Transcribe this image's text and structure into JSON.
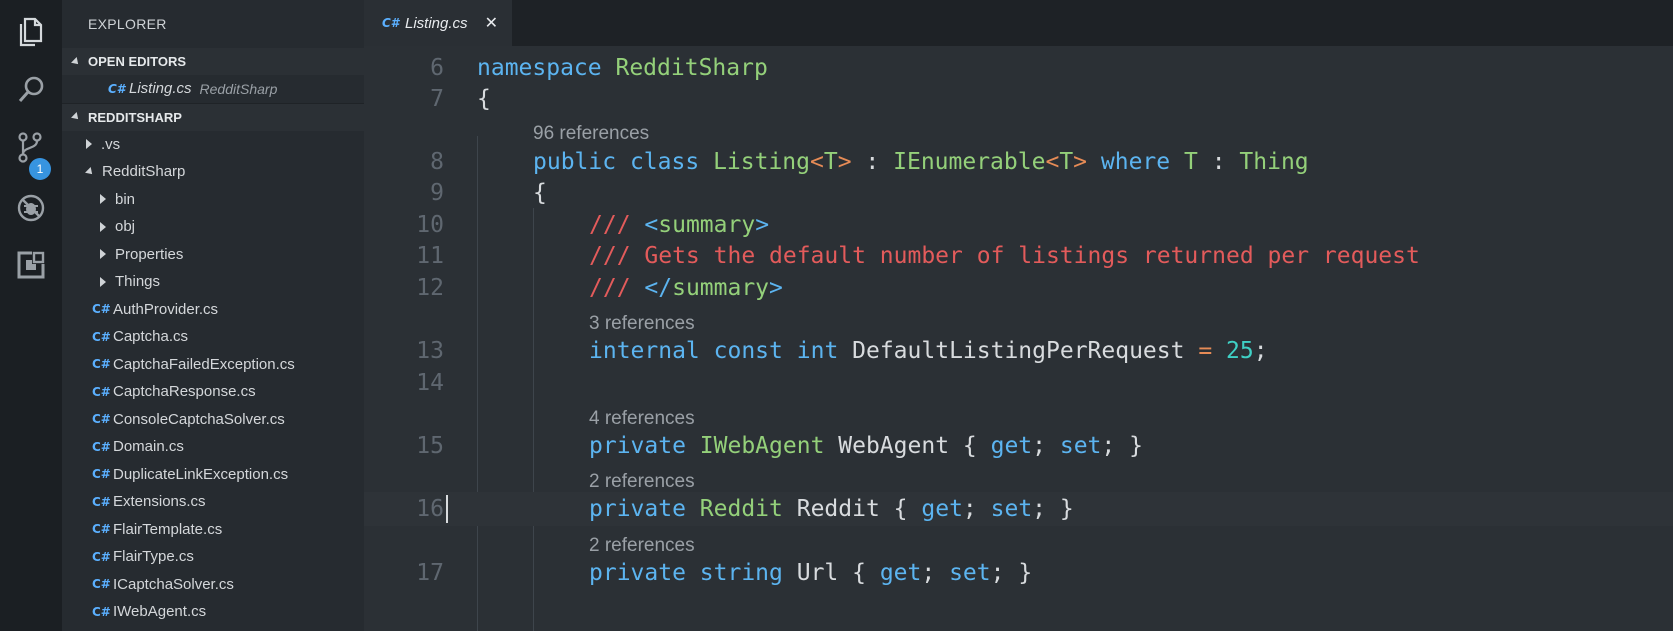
{
  "activity": {
    "items": [
      {
        "name": "explorer-icon"
      },
      {
        "name": "search-icon"
      },
      {
        "name": "source-control-icon",
        "badge": "1"
      },
      {
        "name": "debug-icon"
      },
      {
        "name": "extensions-icon"
      }
    ]
  },
  "sidebar": {
    "title": "EXPLORER",
    "open_editors": {
      "label": "OPEN EDITORS",
      "files": [
        {
          "name": "Listing.cs",
          "project": "RedditSharp"
        }
      ]
    },
    "project": {
      "label": "REDDITSHARP",
      "items": [
        {
          "label": ".vs",
          "type": "folder",
          "depth": 1,
          "expanded": false
        },
        {
          "label": "RedditSharp",
          "type": "folder",
          "depth": 1,
          "expanded": true
        },
        {
          "label": "bin",
          "type": "folder",
          "depth": 2,
          "expanded": false
        },
        {
          "label": "obj",
          "type": "folder",
          "depth": 2,
          "expanded": false
        },
        {
          "label": "Properties",
          "type": "folder",
          "depth": 2,
          "expanded": false
        },
        {
          "label": "Things",
          "type": "folder",
          "depth": 2,
          "expanded": false
        },
        {
          "label": "AuthProvider.cs",
          "type": "file",
          "depth": 2
        },
        {
          "label": "Captcha.cs",
          "type": "file",
          "depth": 2
        },
        {
          "label": "CaptchaFailedException.cs",
          "type": "file",
          "depth": 2
        },
        {
          "label": "CaptchaResponse.cs",
          "type": "file",
          "depth": 2
        },
        {
          "label": "ConsoleCaptchaSolver.cs",
          "type": "file",
          "depth": 2
        },
        {
          "label": "Domain.cs",
          "type": "file",
          "depth": 2
        },
        {
          "label": "DuplicateLinkException.cs",
          "type": "file",
          "depth": 2
        },
        {
          "label": "Extensions.cs",
          "type": "file",
          "depth": 2
        },
        {
          "label": "FlairTemplate.cs",
          "type": "file",
          "depth": 2
        },
        {
          "label": "FlairType.cs",
          "type": "file",
          "depth": 2
        },
        {
          "label": "ICaptchaSolver.cs",
          "type": "file",
          "depth": 2
        },
        {
          "label": "IWebAgent.cs",
          "type": "file",
          "depth": 2
        }
      ]
    }
  },
  "tab": {
    "label": "Listing.cs",
    "icon": "C#",
    "close": "✕"
  },
  "editor": {
    "lines": [
      {
        "num": "6",
        "indent": 0,
        "tokens": [
          [
            "kw",
            "namespace"
          ],
          [
            "pl",
            " "
          ],
          [
            "ty",
            "RedditSharp"
          ]
        ]
      },
      {
        "num": "7",
        "indent": 0,
        "tokens": [
          [
            "pl",
            "{"
          ]
        ]
      },
      {
        "num": "8",
        "indent": 1,
        "lens": "96 references",
        "tokens": [
          [
            "kw",
            "public"
          ],
          [
            "pl",
            " "
          ],
          [
            "kw",
            "class"
          ],
          [
            "pl",
            " "
          ],
          [
            "ty",
            "Listing"
          ],
          [
            "op",
            "<"
          ],
          [
            "ty",
            "T"
          ],
          [
            "op",
            ">"
          ],
          [
            "pl",
            " : "
          ],
          [
            "ty",
            "IEnumerable"
          ],
          [
            "op",
            "<"
          ],
          [
            "ty",
            "T"
          ],
          [
            "op",
            ">"
          ],
          [
            "pl",
            " "
          ],
          [
            "kw",
            "where"
          ],
          [
            "pl",
            " "
          ],
          [
            "ty",
            "T"
          ],
          [
            "pl",
            " : "
          ],
          [
            "ty",
            "Thing"
          ]
        ]
      },
      {
        "num": "9",
        "indent": 1,
        "tokens": [
          [
            "pl",
            "{"
          ]
        ]
      },
      {
        "num": "10",
        "indent": 2,
        "tokens": [
          [
            "cm",
            "/// "
          ],
          [
            "kw",
            "<"
          ],
          [
            "ty",
            "summary"
          ],
          [
            "kw",
            ">"
          ]
        ]
      },
      {
        "num": "11",
        "indent": 2,
        "tokens": [
          [
            "cm",
            "/// Gets the default number of listings returned per request"
          ]
        ]
      },
      {
        "num": "12",
        "indent": 2,
        "tokens": [
          [
            "cm",
            "/// "
          ],
          [
            "kw",
            "</"
          ],
          [
            "ty",
            "summary"
          ],
          [
            "kw",
            ">"
          ]
        ]
      },
      {
        "num": "13",
        "indent": 2,
        "lens": "3 references",
        "tokens": [
          [
            "kw",
            "internal"
          ],
          [
            "pl",
            " "
          ],
          [
            "kw",
            "const"
          ],
          [
            "pl",
            " "
          ],
          [
            "kw",
            "int"
          ],
          [
            "pl",
            " DefaultListingPerRequest "
          ],
          [
            "op",
            "="
          ],
          [
            "pl",
            " "
          ],
          [
            "num",
            "25"
          ],
          [
            "pl",
            ";"
          ]
        ]
      },
      {
        "num": "14",
        "indent": 2,
        "tokens": []
      },
      {
        "num": "15",
        "indent": 2,
        "lens": "4 references",
        "tokens": [
          [
            "kw",
            "private"
          ],
          [
            "pl",
            " "
          ],
          [
            "ty",
            "IWebAgent"
          ],
          [
            "pl",
            " WebAgent { "
          ],
          [
            "kw",
            "get"
          ],
          [
            "pl",
            "; "
          ],
          [
            "kw",
            "set"
          ],
          [
            "pl",
            "; }"
          ]
        ]
      },
      {
        "num": "16",
        "indent": 2,
        "lens": "2 references",
        "cursor": true,
        "tokens": [
          [
            "kw",
            "private"
          ],
          [
            "pl",
            " "
          ],
          [
            "ty",
            "Reddit"
          ],
          [
            "pl",
            " Reddit { "
          ],
          [
            "kw",
            "get"
          ],
          [
            "pl",
            "; "
          ],
          [
            "kw",
            "set"
          ],
          [
            "pl",
            "; }"
          ]
        ]
      },
      {
        "num": "17",
        "indent": 2,
        "lens": "2 references",
        "tokens": [
          [
            "kw",
            "private"
          ],
          [
            "pl",
            " "
          ],
          [
            "kw",
            "string"
          ],
          [
            "pl",
            " Url { "
          ],
          [
            "kw",
            "get"
          ],
          [
            "pl",
            "; "
          ],
          [
            "kw",
            "set"
          ],
          [
            "pl",
            "; }"
          ]
        ]
      }
    ]
  }
}
